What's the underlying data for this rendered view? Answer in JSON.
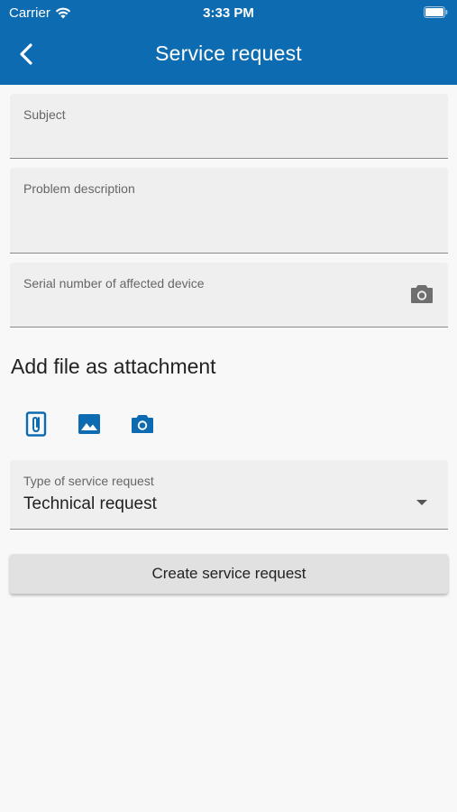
{
  "status_bar": {
    "carrier": "Carrier",
    "time": "3:33 PM"
  },
  "header": {
    "title": "Service request"
  },
  "form": {
    "subject_label": "Subject",
    "description_label": "Problem description",
    "serial_label": "Serial number of affected device",
    "attachment_heading": "Add file as attachment",
    "attachment_icons": [
      "file-attachment-icon",
      "image-icon",
      "camera-icon"
    ],
    "request_type_label": "Type of service request",
    "request_type_value": "Technical request",
    "submit_label": "Create service request"
  },
  "colors": {
    "primary": "#0d6cb1",
    "field_bg": "#efefef",
    "page_bg": "#f8f8f8"
  }
}
